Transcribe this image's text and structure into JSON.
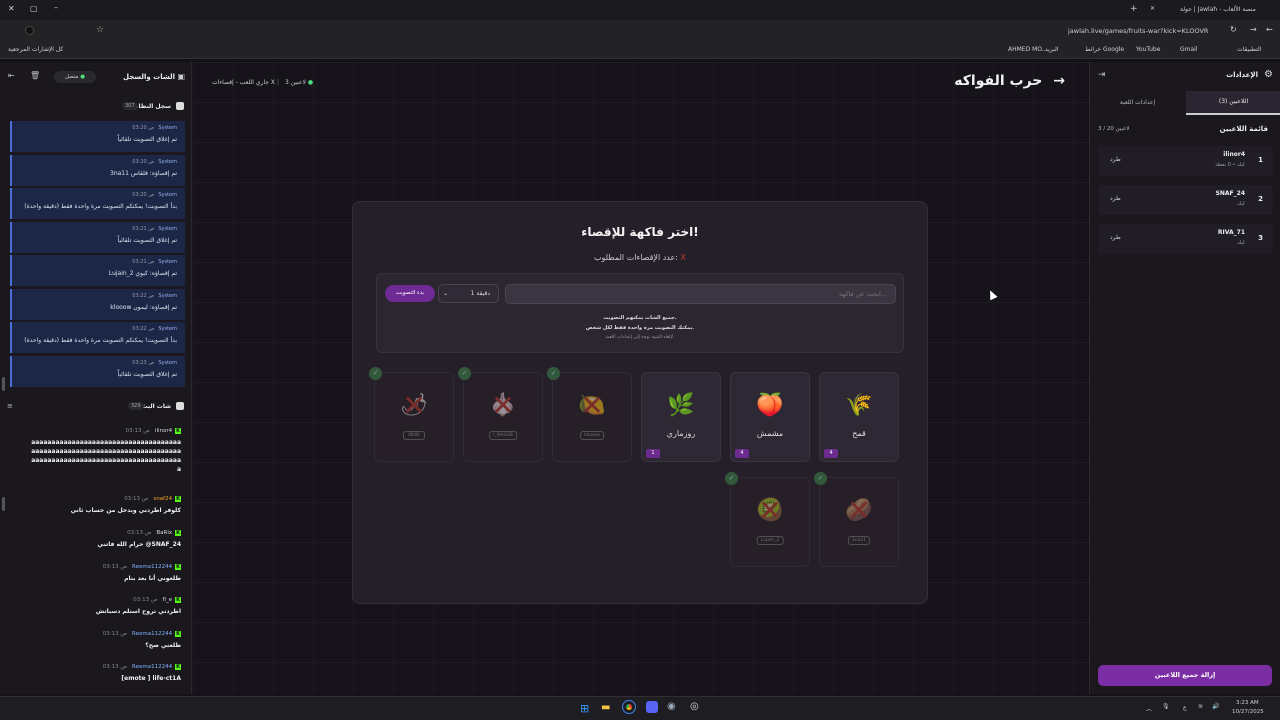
{
  "browser": {
    "tab_title": "جولة | Jawlah - منصة الألعاب",
    "url": "jawlah.live/games/fruits-war?kick=KLOOVR",
    "bookmarks": [
      "التطبيقات",
      "Gmail",
      "YouTube",
      "خرائط Google",
      "البريد",
      "AHMED MO..."
    ],
    "all_bookmarks": "كل الإشارات المرجعية"
  },
  "chat": {
    "title": "الشات والسجل",
    "status": "متصل",
    "system_log_title": "سجل النظام",
    "system_log_count": "307",
    "logs": [
      {
        "who": "System",
        "time": "03:20 ص",
        "msg": "تم إغلاق التصويت تلقائياً"
      },
      {
        "who": "System",
        "time": "03:20 ص",
        "msg": "3na11 تم إقصاؤه: قلقاس"
      },
      {
        "who": "System",
        "time": "03:20 ص",
        "msg": "بدأ التصويت! يمكنكم التصويت مرة واحدة فقط (دقيقة واحدة)"
      },
      {
        "who": "System",
        "time": "03:21 ص",
        "msg": "تم إغلاق التصويت تلقائياً"
      },
      {
        "who": "System",
        "time": "03:21 ص",
        "msg": "Lujain_2 تم إقصاؤه: كيوي"
      },
      {
        "who": "System",
        "time": "03:22 ص",
        "msg": "klooow تم إقصاؤه: ليمون"
      },
      {
        "who": "System",
        "time": "03:22 ص",
        "msg": "بدأ التصويت! يمكنكم التصويت مرة واحدة فقط (دقيقة واحدة)"
      },
      {
        "who": "System",
        "time": "03:23 ص",
        "msg": "تم إغلاق التصويت تلقائياً"
      }
    ],
    "live_title": "شات البث",
    "live_count": "329",
    "messages": [
      {
        "who": "ilinor4",
        "time": "03:13 ص",
        "lines": [
          "aaaaaaaaaaaaaaaaaaaaaaaaaaaaaaaaaaaaa",
          "aaaaaaaaaaaaaaaaaaaaaaaaaaaaaaaaaaaaa",
          "aaaaaaaaaaaaaaaaaaaaaaaaaaaaaaaaaaaaa",
          "a"
        ]
      },
      {
        "who": "snaf24",
        "time": "03:13 ص",
        "lines": [
          "كلوفر اطردني وبدخل من حساب ثاني"
        ]
      },
      {
        "who": "BaRix",
        "time": "03:13 ص",
        "lines": [
          "حرام الله فاتني @SNAF_24"
        ]
      },
      {
        "who": "Reema112244",
        "time": "03:13 ص",
        "lines": [
          "طلعوني أنا بعد بنام"
        ]
      },
      {
        "who": "fl_e",
        "time": "03:13 ص",
        "lines": [
          "اطردني نروح استلم دسباتش"
        ]
      },
      {
        "who": "Reema112244",
        "time": "03:13 ص",
        "lines": [
          "طلعني صح؟"
        ]
      },
      {
        "who": "Reema112244",
        "time": "03:13 ص",
        "lines": [
          "[emote ] life-ct1A"
        ]
      }
    ]
  },
  "main": {
    "game_title": "حرب الفواكه",
    "status_players": "3 لاعبين",
    "status_game": "جاري اللعب - إقصاءات X",
    "card_title": "اختر فاكهة للإقصاء!",
    "required_label": "عدد الإقصاءات المطلوب:",
    "required_value": "X",
    "search_placeholder": "ابحث عن فاكهة...",
    "duration_value": "1 دقيقة",
    "start_vote": "بدء التصويت",
    "info_line1": "جميع الشات يمكنهم التصويت.",
    "info_line2": "يمكنك التصويت مرة واحدة فقط لكل شخص.",
    "info_line3": "لإلغاء التنبيه توجه إلى إعدادات اللعبة.",
    "fruits": [
      {
        "name": "قمح",
        "icon": "wheat-icon",
        "count": "4",
        "eliminated": false,
        "player": ""
      },
      {
        "name": "مشمش",
        "icon": "apricot-icon",
        "count": "4",
        "eliminated": false,
        "player": ""
      },
      {
        "name": "روزماري",
        "icon": "rosemary-icon",
        "count": "1",
        "eliminated": false,
        "player": ""
      },
      {
        "name": "ليمون",
        "icon": "lemon-icon",
        "count": "",
        "eliminated": true,
        "player": "klooow"
      },
      {
        "name": "ثوم",
        "icon": "garlic-icon",
        "count": "",
        "eliminated": true,
        "player": "l_MAG08"
      },
      {
        "name": "فجل",
        "icon": "radish-icon",
        "count": "",
        "eliminated": true,
        "player": "lllllllll"
      },
      {
        "name": "قلقاس",
        "icon": "taro-icon",
        "count": "",
        "eliminated": true,
        "player": "3na11"
      },
      {
        "name": "كيوي",
        "icon": "kiwi-icon",
        "count": "",
        "eliminated": true,
        "player": "Lujain_2"
      }
    ]
  },
  "settings": {
    "title": "الإعدادات",
    "tab_players": "اللاعبين (3)",
    "tab_game": "إعدادات اللعبة",
    "list_title": "قائمة اللاعبين",
    "list_count": "3 / 20 لاعبين",
    "players": [
      {
        "rank": "1",
        "name": "ilinor4",
        "sub": "كيك • 0 نقطة",
        "kick": "طرد"
      },
      {
        "rank": "2",
        "name": "SNAF_24",
        "sub": "كيك",
        "kick": "طرد"
      },
      {
        "rank": "3",
        "name": "RIVA_71",
        "sub": "كيك",
        "kick": "طرد"
      }
    ],
    "remove_all": "إزالة جميع اللاعبين"
  },
  "taskbar": {
    "time": "3:23 AM",
    "date": "10/27/2025",
    "lang": "ع"
  },
  "colors": {
    "accent": "#7b2ea3",
    "kick_green": "#53fc18",
    "online": "#4ade80"
  }
}
